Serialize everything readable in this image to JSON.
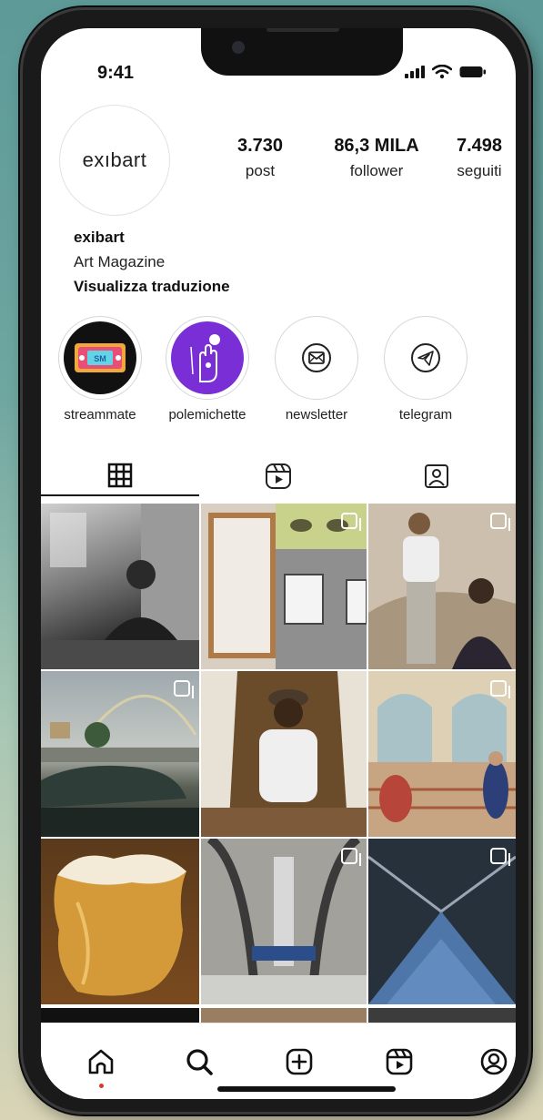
{
  "status_bar": {
    "time": "9:41"
  },
  "profile": {
    "avatar_text": "exıbart",
    "stats": [
      {
        "value": "3.730",
        "label": "post"
      },
      {
        "value": "86,3 MILA",
        "label": "follower"
      },
      {
        "value": "7.498",
        "label": "seguiti"
      }
    ],
    "name": "exibart",
    "category": "Art Magazine",
    "translate_link": "Visualizza traduzione"
  },
  "highlights": [
    {
      "label": "streammate",
      "icon": "vhs-tape-icon"
    },
    {
      "label": "polemichette",
      "icon": "hand-icon"
    },
    {
      "label": "newsletter",
      "icon": "envelope-icon"
    },
    {
      "label": "telegram",
      "icon": "telegram-icon"
    }
  ],
  "tabs": [
    {
      "name": "grid",
      "icon": "grid-icon"
    },
    {
      "name": "reels",
      "icon": "reels-icon"
    },
    {
      "name": "tagged",
      "icon": "tagged-user-icon"
    }
  ],
  "bottom_nav": [
    {
      "name": "home",
      "icon": "home-icon"
    },
    {
      "name": "search",
      "icon": "search-icon"
    },
    {
      "name": "create",
      "icon": "add-post-icon"
    },
    {
      "name": "reels",
      "icon": "reels-icon"
    },
    {
      "name": "profile",
      "icon": "profile-icon"
    }
  ],
  "colors": {
    "accent_dot": "#e0342f",
    "highlight_purple": "#7a2fd6"
  }
}
